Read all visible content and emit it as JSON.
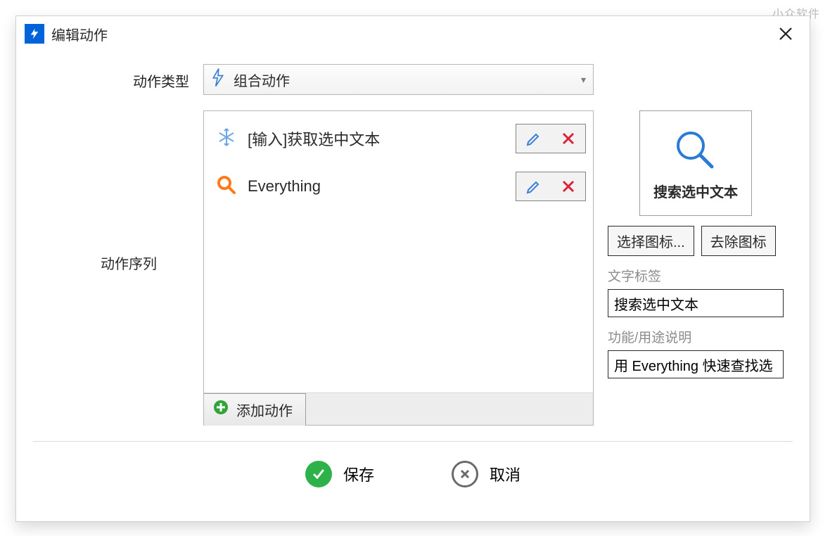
{
  "watermark": "小众软件",
  "dialog": {
    "title": "编辑动作",
    "labels": {
      "action_type": "动作类型",
      "action_sequence": "动作序列"
    },
    "action_type": {
      "selected": "组合动作"
    },
    "sequence": [
      {
        "label": "[输入]获取选中文本",
        "icon": "snowflake"
      },
      {
        "label": "Everything",
        "icon": "magnifier-orange"
      }
    ],
    "add_action": "添加动作",
    "side": {
      "preview_text": "搜索选中文本",
      "choose_icon_btn": "选择图标...",
      "remove_icon_btn": "去除图标",
      "text_label_caption": "文字标签",
      "text_label_value": "搜索选中文本",
      "desc_caption": "功能/用途说明",
      "desc_value": "用 Everything 快速查找选"
    },
    "footer": {
      "save": "保存",
      "cancel": "取消"
    }
  }
}
